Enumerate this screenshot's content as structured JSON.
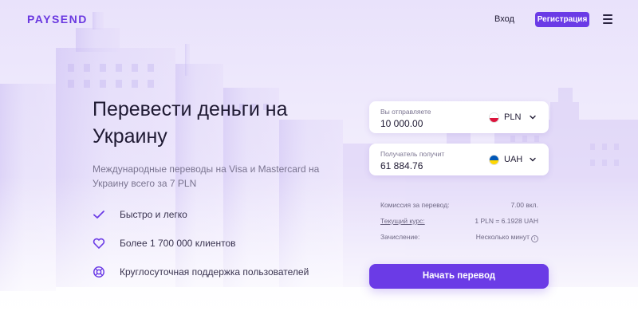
{
  "header": {
    "logo": "PAYSEND",
    "login": "Вход",
    "register": "Регистрация"
  },
  "hero": {
    "title": "Перевести деньги на Украину",
    "subtitle": "Международные переводы на Visa и Mastercard на Украину всего за 7 PLN"
  },
  "features": [
    {
      "icon": "check-icon",
      "text": "Быстро и легко"
    },
    {
      "icon": "heart-icon",
      "text": "Более 1 700 000 клиентов"
    },
    {
      "icon": "support-icon",
      "text": "Круглосуточная поддержка пользователей"
    }
  ],
  "calculator": {
    "send": {
      "label": "Вы отправляете",
      "value": "10 000.00",
      "currency": "PLN",
      "flag": "poland-flag-icon"
    },
    "receive": {
      "label": "Получатель получит",
      "value": "61 884.76",
      "currency": "UAH",
      "flag": "ukraine-flag-icon"
    },
    "fee": {
      "label": "Комиссия за перевод:",
      "value": "7.00 вкл."
    },
    "rate": {
      "label": "Текущий курс:",
      "value": "1 PLN = 6.1928 UAH"
    },
    "credit": {
      "label": "Зачисление:",
      "value": "Несколько минут"
    },
    "button": "Начать перевод"
  },
  "colors": {
    "accent": "#6b3be6",
    "poland_top": "#ffffff",
    "poland_bottom": "#dc143c",
    "ukraine_top": "#0057b7",
    "ukraine_bottom": "#ffd700"
  }
}
